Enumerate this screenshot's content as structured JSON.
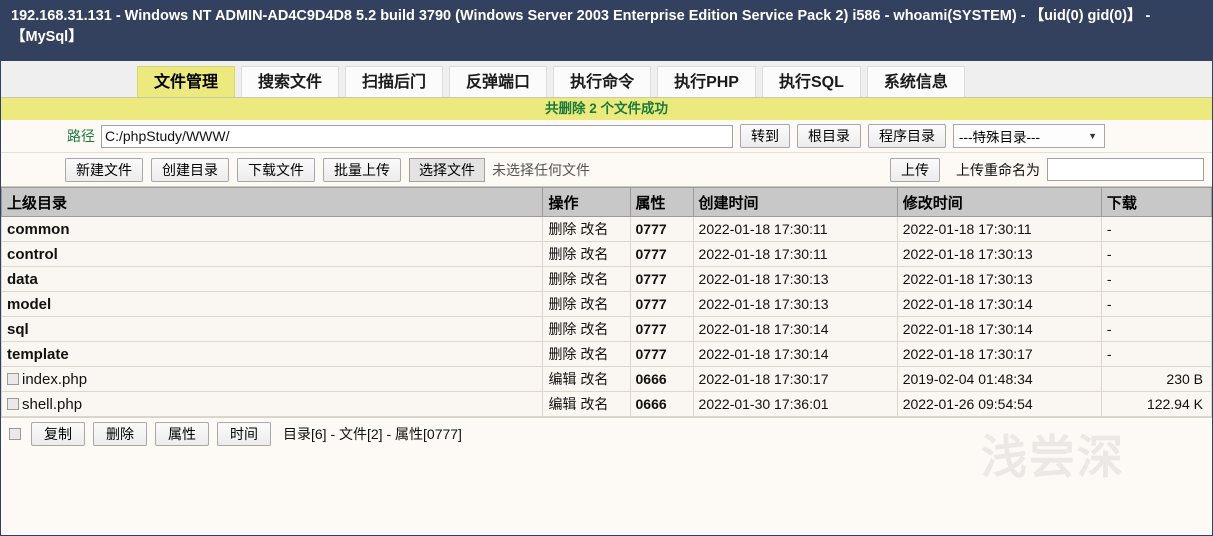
{
  "window": {
    "title": "192.168.31.131 - Windows NT ADMIN-AD4C9D4D8 5.2 build 3790 (Windows Server 2003 Enterprise Edition Service Pack 2) i586 - whoami(SYSTEM) - 【uid(0) gid(0)】 - 【MySql】"
  },
  "tabs": [
    {
      "label": "文件管理",
      "active": true
    },
    {
      "label": "搜索文件",
      "active": false
    },
    {
      "label": "扫描后门",
      "active": false
    },
    {
      "label": "反弹端口",
      "active": false
    },
    {
      "label": "执行命令",
      "active": false
    },
    {
      "label": "执行PHP",
      "active": false
    },
    {
      "label": "执行SQL",
      "active": false
    },
    {
      "label": "系统信息",
      "active": false
    }
  ],
  "message": "共删除 2 个文件成功",
  "path_row": {
    "label": "路径",
    "value": "C:/phpStudy/WWW/",
    "goto_label": "转到",
    "root_label": "根目录",
    "program_label": "程序目录",
    "special_select": "---特殊目录---"
  },
  "toolbar": {
    "new_file": "新建文件",
    "new_dir": "创建目录",
    "download_file": "下载文件",
    "batch_upload": "批量上传",
    "choose_file": "选择文件",
    "no_file_chosen": "未选择任何文件",
    "upload": "上传",
    "rename_label": "上传重命名为",
    "rename_value": ""
  },
  "table": {
    "headers": [
      "上级目录",
      "操作",
      "属性",
      "创建时间",
      "修改时间",
      "下载"
    ],
    "rows": [
      {
        "type": "dir",
        "name": "common",
        "op1": "删除",
        "op2": "改名",
        "attr": "0777",
        "created": "2022-01-18 17:30:11",
        "modified": "2022-01-18 17:30:11",
        "download": "-"
      },
      {
        "type": "dir",
        "name": "control",
        "op1": "删除",
        "op2": "改名",
        "attr": "0777",
        "created": "2022-01-18 17:30:11",
        "modified": "2022-01-18 17:30:13",
        "download": "-"
      },
      {
        "type": "dir",
        "name": "data",
        "op1": "删除",
        "op2": "改名",
        "attr": "0777",
        "created": "2022-01-18 17:30:13",
        "modified": "2022-01-18 17:30:13",
        "download": "-"
      },
      {
        "type": "dir",
        "name": "model",
        "op1": "删除",
        "op2": "改名",
        "attr": "0777",
        "created": "2022-01-18 17:30:13",
        "modified": "2022-01-18 17:30:14",
        "download": "-"
      },
      {
        "type": "dir",
        "name": "sql",
        "op1": "删除",
        "op2": "改名",
        "attr": "0777",
        "created": "2022-01-18 17:30:14",
        "modified": "2022-01-18 17:30:14",
        "download": "-"
      },
      {
        "type": "dir",
        "name": "template",
        "op1": "删除",
        "op2": "改名",
        "attr": "0777",
        "created": "2022-01-18 17:30:14",
        "modified": "2022-01-18 17:30:17",
        "download": "-"
      },
      {
        "type": "file",
        "name": "index.php",
        "op1": "编辑",
        "op2": "改名",
        "attr": "0666",
        "created": "2022-01-18 17:30:17",
        "modified": "2019-02-04 01:48:34",
        "download": "230 B"
      },
      {
        "type": "file",
        "name": "shell.php",
        "op1": "编辑",
        "op2": "改名",
        "attr": "0666",
        "created": "2022-01-30 17:36:01",
        "modified": "2022-01-26 09:54:54",
        "download": "122.94 K"
      }
    ]
  },
  "footer": {
    "copy": "复制",
    "delete": "删除",
    "attr": "属性",
    "time": "时间",
    "summary": "目录[6] - 文件[2] - 属性[0777]"
  },
  "colors": {
    "titlebar_bg": "#33415e",
    "tab_active_bg": "#ece97f",
    "message_fg": "#1a7a3c",
    "header_bg": "#c8c8c8"
  }
}
